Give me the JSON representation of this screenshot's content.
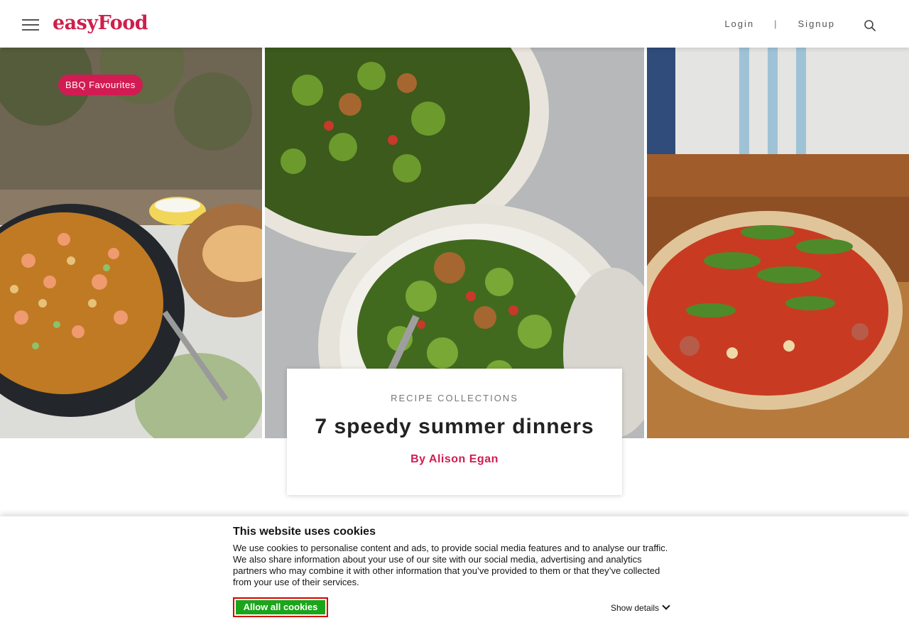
{
  "header": {
    "logo_part1": "easy",
    "logo_part2": "Food",
    "login_label": "Login",
    "separator": "|",
    "signup_label": "Signup"
  },
  "hero": {
    "tag_label": "BBQ Favourites",
    "category": "RECIPE COLLECTIONS",
    "title": "7 speedy summer dinners",
    "author": "By Alison Egan",
    "images": [
      "paella-pan-photo",
      "pasta-shells-pesto-photo",
      "rocket-pizza-photo"
    ]
  },
  "cookie_banner": {
    "title": "This website uses cookies",
    "text": "We use cookies to personalise content and ads, to provide social media features and to analyse our traffic. We also share information about your use of our site with our social media, advertising and analytics partners who may combine it with other information that you’ve provided to them or that they’ve collected from your use of their services.",
    "allow_label": "Allow all cookies",
    "details_label": "Show details"
  },
  "colors": {
    "brand": "#cf1f4c",
    "accent": "#d21b52",
    "allow_green": "#1aa51a",
    "allow_border": "#d60000"
  },
  "icons": [
    "hamburger-icon",
    "search-icon",
    "chevron-down-icon"
  ]
}
